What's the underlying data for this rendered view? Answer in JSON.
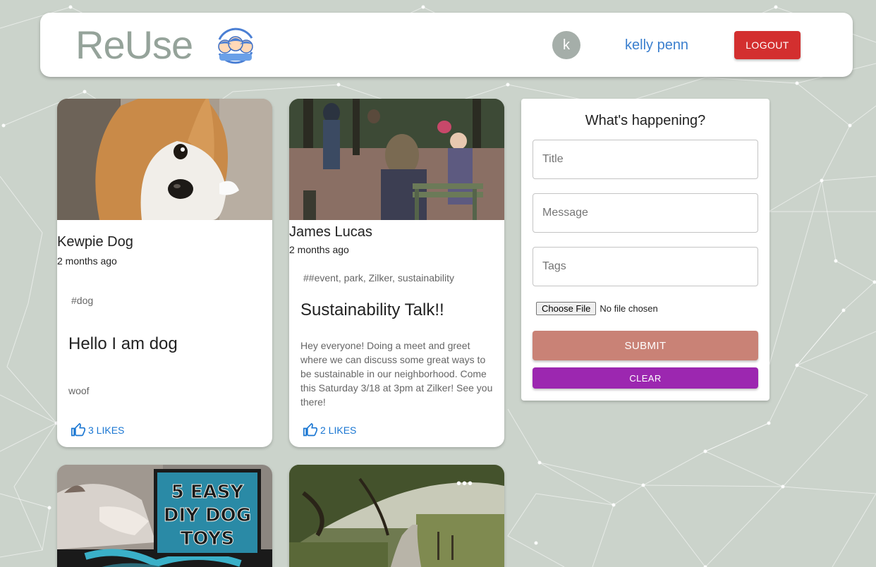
{
  "header": {
    "brand": "ReUse",
    "avatar_initial": "k",
    "username": "kelly penn",
    "logout_label": "LOGOUT"
  },
  "posts": [
    {
      "author": "Kewpie Dog",
      "time": "2 months ago",
      "tags": "#dog",
      "title": "Hello I am dog",
      "message": "woof",
      "likes": "3 LIKES",
      "image": "corgi-photo"
    },
    {
      "author": "James Lucas",
      "time": "2 months ago",
      "tags": "##event, park, Zilker, sustainability",
      "title": "Sustainability Talk!!",
      "message": "Hey everyone! Doing a meet and greet where we can discuss some great ways to be sustainable in our neighborhood. Come this Saturday 3/18 at 3pm at Zilker! See you there!",
      "likes": "2 LIKES",
      "image": "park-gathering-photo"
    },
    {
      "image": "diy-dog-toys-photo",
      "image_text": [
        "5 EASY",
        "DIY DOG",
        "TOYS"
      ]
    },
    {
      "image": "park-trail-photo",
      "more_label": "•••"
    }
  ],
  "form": {
    "title": "What's happening?",
    "title_placeholder": "Title",
    "message_placeholder": "Message",
    "tags_placeholder": "Tags",
    "choose_file_label": "Choose File",
    "no_file_label": "No file chosen",
    "submit_label": "SUBMIT",
    "clear_label": "CLEAR"
  },
  "colors": {
    "background": "#cbd3cb",
    "brand": "#95a39a",
    "username": "#3b7fce",
    "logout": "#d32f2f",
    "submit": "#c98276",
    "clear": "#9c27b0",
    "likes": "#1976d2"
  },
  "icons": [
    "kids-logo-icon",
    "thumb-up-icon",
    "more-icon"
  ]
}
